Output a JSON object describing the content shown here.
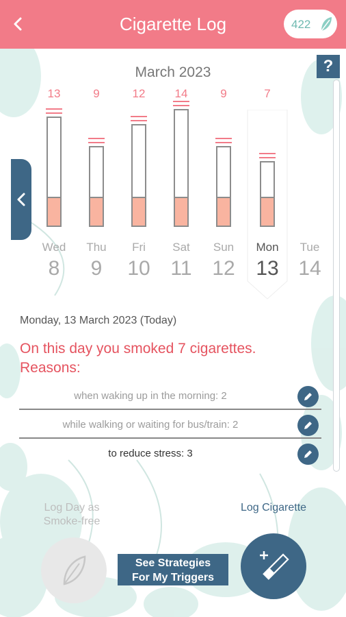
{
  "header": {
    "back_icon": "chevron-left-icon",
    "title": "Cigarette Log",
    "points": "422",
    "points_icon": "leaf-icon"
  },
  "help_label": "?",
  "calendar": {
    "month": "March 2023",
    "days": [
      {
        "name": "Wed",
        "num": "8",
        "count": "13",
        "level": 13,
        "selected": false
      },
      {
        "name": "Thu",
        "num": "9",
        "count": "9",
        "level": 9,
        "selected": false
      },
      {
        "name": "Fri",
        "num": "10",
        "count": "12",
        "level": 12,
        "selected": false
      },
      {
        "name": "Sat",
        "num": "11",
        "count": "14",
        "level": 14,
        "selected": false
      },
      {
        "name": "Sun",
        "num": "12",
        "count": "9",
        "level": 9,
        "selected": false
      },
      {
        "name": "Mon",
        "num": "13",
        "count": "7",
        "level": 7,
        "selected": true
      },
      {
        "name": "Tue",
        "num": "14",
        "count": "",
        "level": 0,
        "selected": false
      }
    ]
  },
  "detail": {
    "date": "Monday, 13 March 2023 (Today)",
    "summary": "On this day you smoked 7 cigarettes.",
    "reasons_title": "Reasons:",
    "reasons": [
      {
        "text": "when waking up in the morning: 2"
      },
      {
        "text": "while walking or waiting for bus/train: 2"
      },
      {
        "text": "to reduce stress: 3"
      }
    ]
  },
  "actions": {
    "smoke_free_label": "Log Day as Smoke-free",
    "strategies_line1": "See Strategies",
    "strategies_line2": "For My Triggers",
    "log_label": "Log Cigarette"
  },
  "colors": {
    "header": "#f27b88",
    "primary": "#3e6786",
    "accent_text": "#e5535f",
    "filter": "#f9b4a0",
    "decor": "#cfe9e4"
  }
}
